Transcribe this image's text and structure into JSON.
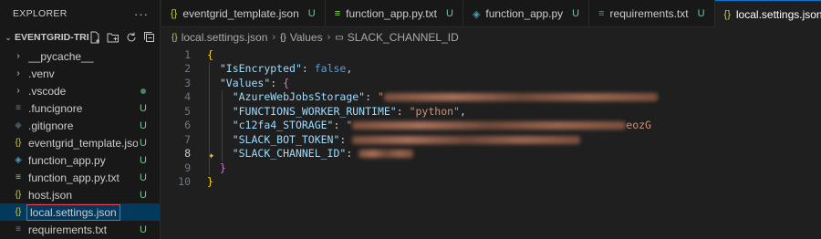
{
  "sidebar": {
    "title": "EXPLORER",
    "more_icon": "ellipsis-icon",
    "folder_name": "EVENTGRID-TRIG...",
    "folder_actions": [
      "new-file-icon",
      "new-folder-icon",
      "refresh-icon",
      "collapse-all-icon"
    ],
    "items": [
      {
        "label": "__pycache__",
        "icon": "chevron-right-icon",
        "icon_glyph": "›",
        "icon_color": "#cccccc",
        "status": "",
        "status_color": "#cccccc"
      },
      {
        "label": ".venv",
        "icon": "chevron-right-icon",
        "icon_glyph": "›",
        "icon_color": "#cccccc",
        "status": "",
        "status_color": "#cccccc"
      },
      {
        "label": ".vscode",
        "icon": "chevron-right-icon",
        "icon_glyph": "›",
        "icon_color": "#cccccc",
        "status": "dot",
        "status_color": "#73c991"
      },
      {
        "label": ".funcignore",
        "icon": "file-lines-icon",
        "icon_glyph": "≡",
        "icon_color": "#6d8086",
        "status": "U",
        "status_color": "#73c991"
      },
      {
        "label": ".gitignore",
        "icon": "git-icon",
        "icon_glyph": "◆",
        "icon_color": "#41535b",
        "status": "U",
        "status_color": "#73c991"
      },
      {
        "label": "eventgrid_template.json",
        "icon": "json-icon",
        "icon_glyph": "{}",
        "icon_color": "#cbcb41",
        "status": "U",
        "status_color": "#73c991"
      },
      {
        "label": "function_app.py",
        "icon": "python-icon",
        "icon_glyph": "◈",
        "icon_color": "#519aba",
        "status": "U",
        "status_color": "#73c991"
      },
      {
        "label": "function_app.py.txt",
        "icon": "file-lines-icon",
        "icon_glyph": "≡",
        "icon_color": "#89e051",
        "status": "U",
        "status_color": "#73c991"
      },
      {
        "label": "host.json",
        "icon": "json-icon",
        "icon_glyph": "{}",
        "icon_color": "#cbcb41",
        "status": "U",
        "status_color": "#73c991"
      },
      {
        "label": "local.settings.json",
        "icon": "json-icon",
        "icon_glyph": "{}",
        "icon_color": "#cbcb41",
        "status": "",
        "status_color": "#73c991",
        "selected": true
      },
      {
        "label": "requirements.txt",
        "icon": "file-lines-icon",
        "icon_glyph": "≡",
        "icon_color": "#6d8086",
        "status": "U",
        "status_color": "#73c991"
      }
    ]
  },
  "tabs": [
    {
      "label": "eventgrid_template.json",
      "icon": "json-icon",
      "icon_glyph": "{}",
      "icon_color": "#cbcb41",
      "status": "U"
    },
    {
      "label": "function_app.py.txt",
      "icon": "file-lines-icon",
      "icon_glyph": "≡",
      "icon_color": "#89e051",
      "status": "U"
    },
    {
      "label": "function_app.py",
      "icon": "python-icon",
      "icon_glyph": "◈",
      "icon_color": "#519aba",
      "status": "U"
    },
    {
      "label": "requirements.txt",
      "icon": "file-lines-icon",
      "icon_glyph": "≡",
      "icon_color": "#6d8086",
      "status": "U"
    },
    {
      "label": "local.settings.json",
      "icon": "json-icon",
      "icon_glyph": "{}",
      "icon_color": "#cbcb41",
      "status": "",
      "active": true,
      "close": "×"
    }
  ],
  "breadcrumb": {
    "file": "local.settings.json",
    "seg1": "Values",
    "seg2": "SLACK_CHANNEL_ID",
    "sep": "›",
    "file_icon": "{}",
    "seg1_icon": "{}",
    "seg2_icon": "▭"
  },
  "editor": {
    "current_line": 8,
    "lines": [
      {
        "n": "1",
        "tokens": [
          {
            "t": "{",
            "c": "br1"
          }
        ]
      },
      {
        "n": "2",
        "tokens": [
          {
            "t": "  ",
            "c": "p"
          },
          {
            "t": "\"IsEncrypted\"",
            "c": "k"
          },
          {
            "t": ": ",
            "c": "p"
          },
          {
            "t": "false",
            "c": "b"
          },
          {
            "t": ",",
            "c": "p"
          }
        ]
      },
      {
        "n": "3",
        "tokens": [
          {
            "t": "  ",
            "c": "p"
          },
          {
            "t": "\"Values\"",
            "c": "k"
          },
          {
            "t": ": ",
            "c": "p"
          },
          {
            "t": "{",
            "c": "br2"
          }
        ]
      },
      {
        "n": "4",
        "tokens": [
          {
            "t": "    ",
            "c": "p"
          },
          {
            "t": "\"AzureWebJobsStorage\"",
            "c": "k"
          },
          {
            "t": ": ",
            "c": "p"
          },
          {
            "t": "\"",
            "c": "s"
          },
          {
            "blur": 500
          }
        ]
      },
      {
        "n": "5",
        "tokens": [
          {
            "t": "    ",
            "c": "p"
          },
          {
            "t": "\"FUNCTIONS_WORKER_RUNTIME\"",
            "c": "k"
          },
          {
            "t": ": ",
            "c": "p"
          },
          {
            "t": "\"python\"",
            "c": "s"
          },
          {
            "t": ",",
            "c": "p"
          }
        ]
      },
      {
        "n": "6",
        "tokens": [
          {
            "t": "    ",
            "c": "p"
          },
          {
            "t": "\"c12fa4_STORAGE\"",
            "c": "k"
          },
          {
            "t": ": ",
            "c": "p"
          },
          {
            "t": "\"",
            "c": "s"
          },
          {
            "blur": 470
          },
          {
            "t": "eozG",
            "c": "s"
          }
        ]
      },
      {
        "n": "7",
        "tokens": [
          {
            "t": "    ",
            "c": "p"
          },
          {
            "t": "\"SLACK_BOT_TOKEN\"",
            "c": "k"
          },
          {
            "t": ": ",
            "c": "p"
          },
          {
            "blur": 380
          }
        ]
      },
      {
        "n": "8",
        "tokens": [
          {
            "t": "    ",
            "c": "p"
          },
          {
            "t": "\"SLACK_CHANNEL_ID\"",
            "c": "k"
          },
          {
            "t": ": ",
            "c": "p"
          },
          {
            "blur": 70
          }
        ]
      },
      {
        "n": "9",
        "tokens": [
          {
            "t": "  ",
            "c": "p"
          },
          {
            "t": "}",
            "c": "br2"
          }
        ]
      },
      {
        "n": "10",
        "tokens": [
          {
            "t": "}",
            "c": "br1"
          }
        ]
      }
    ]
  },
  "colors": {
    "accent": "#0078d4",
    "untracked": "#73c991",
    "selection_outline": "#e0475a"
  }
}
